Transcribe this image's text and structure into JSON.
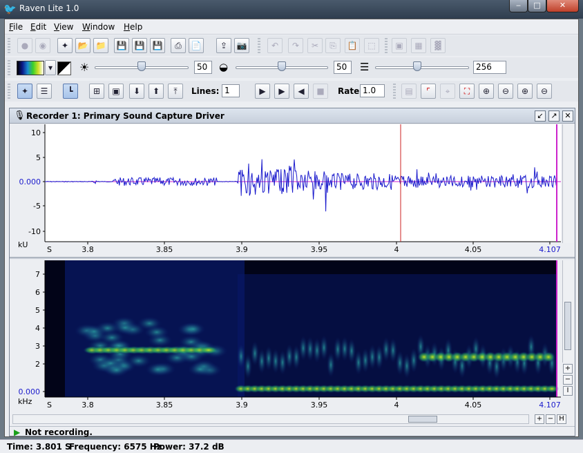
{
  "window": {
    "title": "Raven Lite 1.0"
  },
  "menu": [
    {
      "label": "File",
      "key": "F",
      "rest": "ile"
    },
    {
      "label": "Edit",
      "key": "E",
      "rest": "dit"
    },
    {
      "label": "View",
      "key": "V",
      "rest": "iew"
    },
    {
      "label": "Window",
      "key": "W",
      "rest": "indow"
    },
    {
      "label": "Help",
      "key": "H",
      "rest": "elp"
    }
  ],
  "display_toolbar": {
    "brightness": {
      "value": "50",
      "level": 0.5
    },
    "contrast": {
      "value": "50",
      "level": 0.5
    },
    "window_size": {
      "value": "256",
      "level": 0.45
    }
  },
  "view_toolbar": {
    "lines_label": "Lines:",
    "lines_value": "1",
    "rate_label": "Rate:",
    "rate_value": "1.0"
  },
  "panel": {
    "title": "Recorder 1: Primary Sound Capture Driver"
  },
  "waveform": {
    "y_unit": "kU",
    "y_ticks": [
      "10",
      "5",
      "0.000",
      "-5",
      "-10"
    ],
    "x_unit": "S",
    "x_ticks": [
      "3.8",
      "3.85",
      "3.9",
      "3.95",
      "4",
      "4.05",
      "4.107"
    ]
  },
  "spectrogram": {
    "y_unit": "kHz",
    "y_ticks": [
      "7",
      "6",
      "5",
      "4",
      "3",
      "2",
      "0.000"
    ],
    "x_unit": "S",
    "x_ticks": [
      "3.8",
      "3.85",
      "3.9",
      "3.95",
      "4",
      "4.05",
      "4.107"
    ]
  },
  "status": {
    "recording": "Not recording."
  },
  "readout": {
    "time": "Time: 3.801 S",
    "frequency": "Frequency: 6575 Hz",
    "power": "Power: 37.2 dB"
  },
  "colors": {
    "accent": "#1a1acc",
    "cursor": "#cc2222",
    "selection": "#cc22cc"
  }
}
